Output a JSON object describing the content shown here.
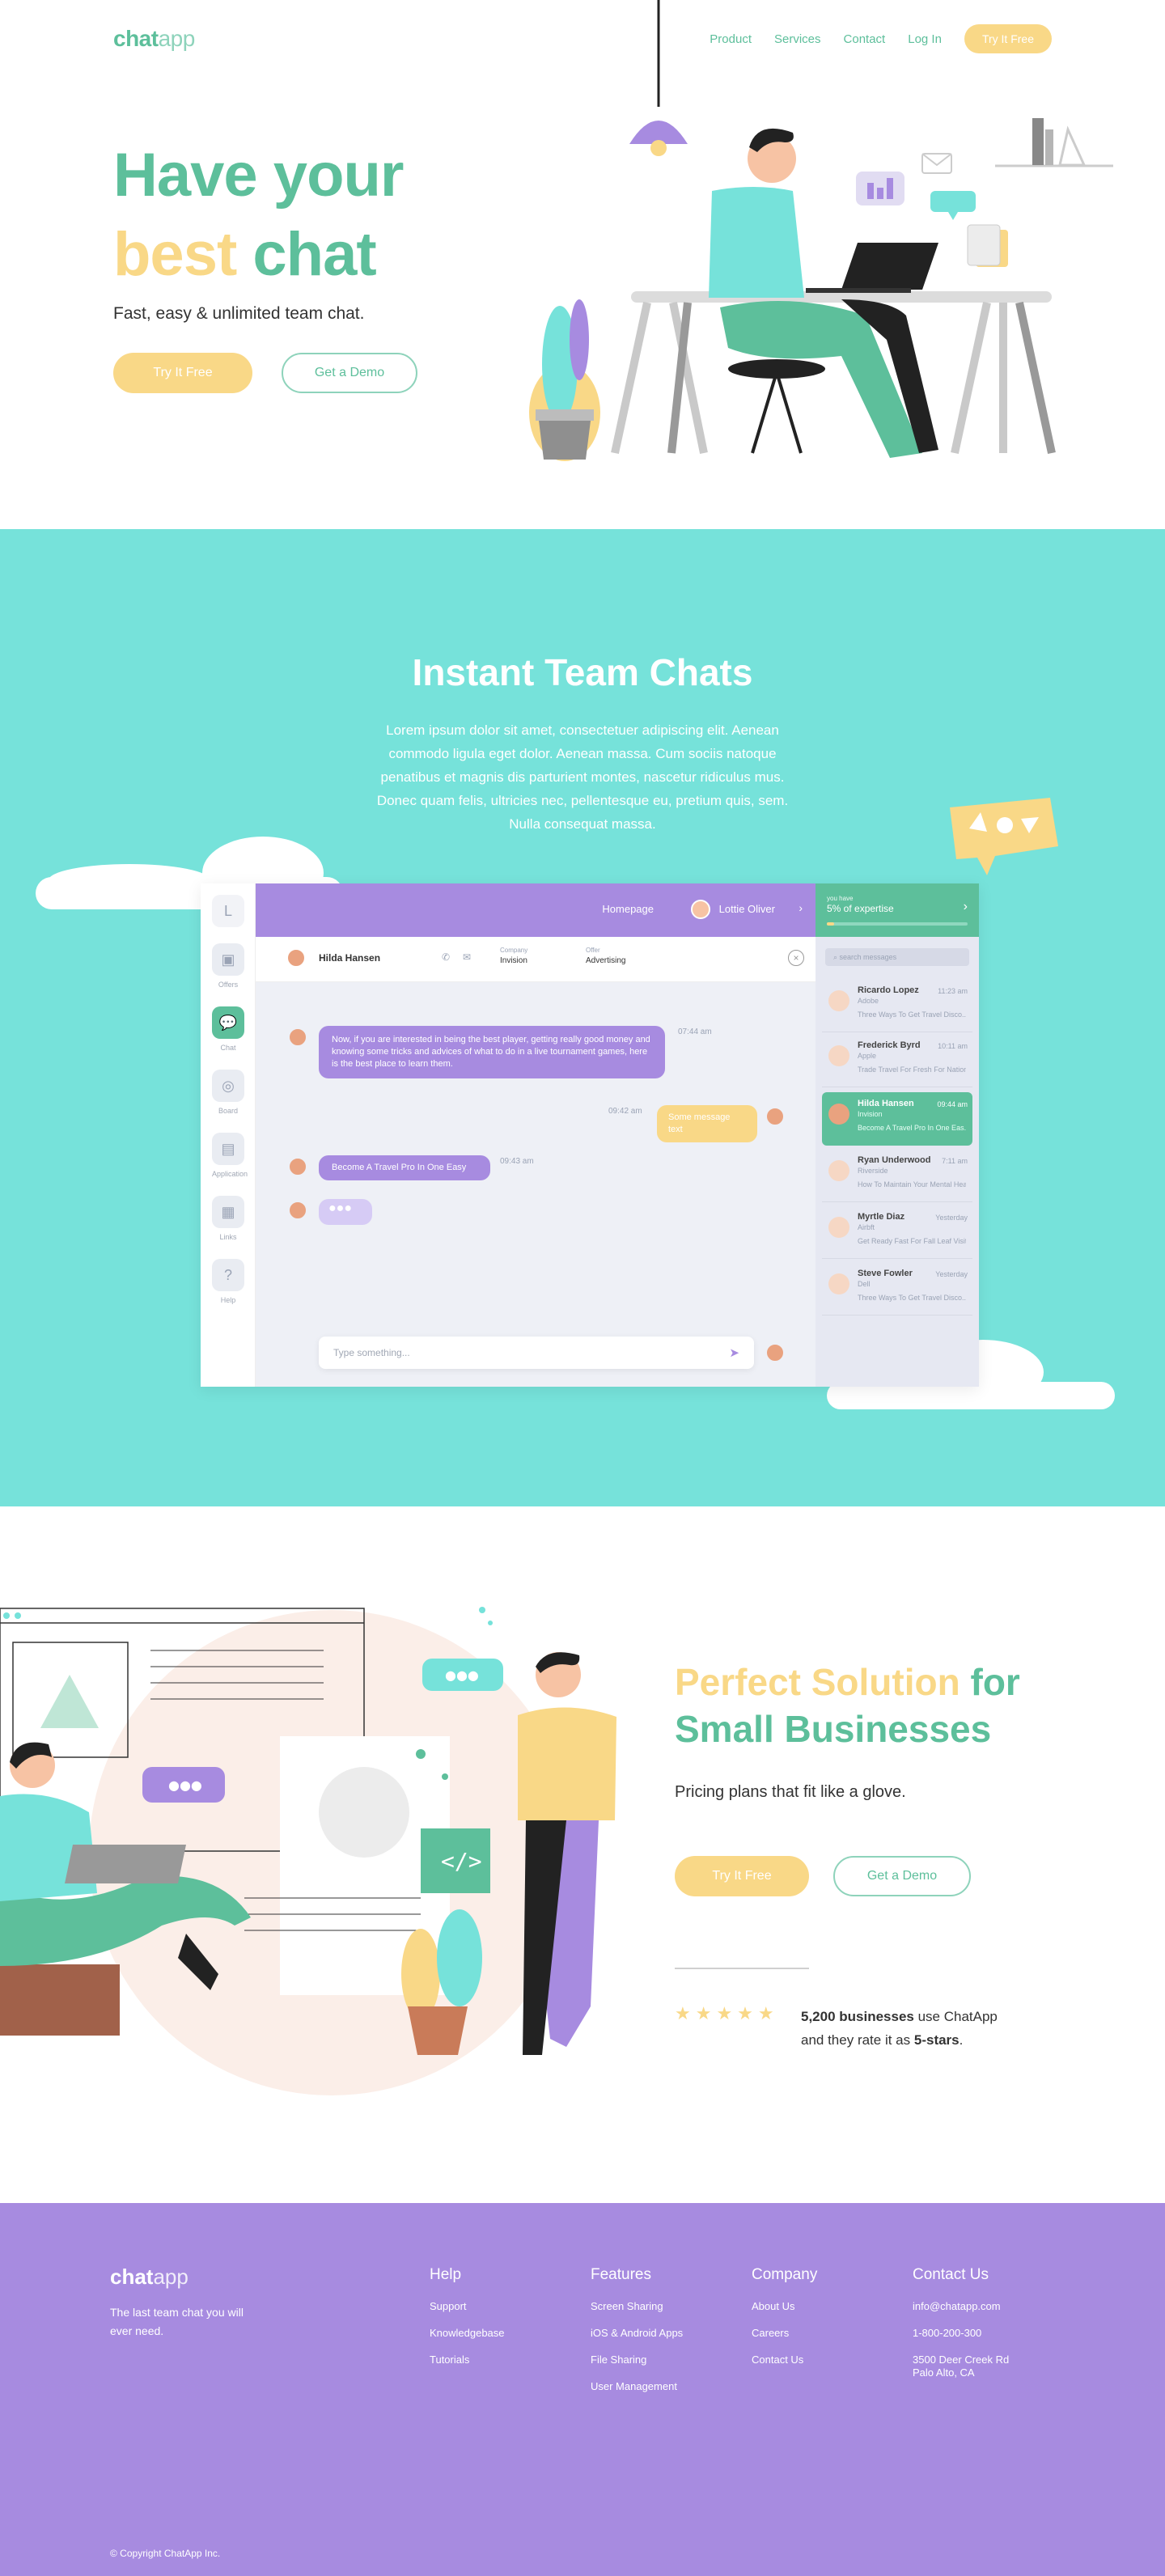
{
  "brand": {
    "logo_bold": "chat",
    "logo_light": "app"
  },
  "nav": {
    "items": [
      "Product",
      "Services",
      "Contact",
      "Log In"
    ],
    "cta": "Try It Free"
  },
  "hero": {
    "title_line1": "Have your",
    "title_line2_yellow": "best",
    "title_line2_green": " chat",
    "subtitle": "Fast, easy & unlimited team chat.",
    "primary_btn": "Try It Free",
    "secondary_btn": "Get a Demo"
  },
  "team_chats": {
    "title": "Instant Team Chats",
    "text": "Lorem ipsum dolor sit amet, consectetuer adipiscing elit. Aenean commodo ligula eget dolor. Aenean massa. Cum sociis natoque penatibus et magnis dis parturient montes, nascetur ridiculus mus. Donec quam felis, ultricies nec, pellentesque eu, pretium quis, sem. Nulla consequat massa."
  },
  "app": {
    "sidebar": [
      "Offers",
      "Chat",
      "Board",
      "Application",
      "Links",
      "Help"
    ],
    "top_bar": {
      "home": "Homepage",
      "user": "Lottie Oliver"
    },
    "chat_header": {
      "name": "Hilda Hansen",
      "company_label": "Company",
      "company": "Invision",
      "offer_label": "Offer",
      "offer": "Advertising"
    },
    "messages": [
      {
        "text": "Now, if you are interested in being the best player, getting really good money and knowing some tricks and advices of what to do in a live tournament games, here is the best place to learn them.",
        "time": "07:44 am"
      },
      {
        "text": "Some message text",
        "time": "09:42 am"
      },
      {
        "text": "Become A Travel Pro In One Easy",
        "time": "09:43 am"
      }
    ],
    "input_placeholder": "Type something...",
    "panel": {
      "label": "you have",
      "value": "5% of expertise",
      "search": "search messages"
    },
    "contacts": [
      {
        "name": "Ricardo Lopez",
        "role": "Adobe",
        "message": "Three Ways To Get Travel Disco...",
        "time": "11:23 am"
      },
      {
        "name": "Frederick Byrd",
        "role": "Apple",
        "message": "Trade Travel For Fresh For Nations",
        "time": "10:11 am"
      },
      {
        "name": "Hilda Hansen",
        "role": "Invision",
        "message": "Become A Travel Pro In One Eas...",
        "time": "09:44 am"
      },
      {
        "name": "Ryan Underwood",
        "role": "Riverside",
        "message": "How To Maintain Your Mental Heal...",
        "time": "7:11 am"
      },
      {
        "name": "Myrtle Diaz",
        "role": "Airbft",
        "message": "Get Ready Fast For Fall Leaf Visits",
        "time": "Yesterday"
      },
      {
        "name": "Steve Fowler",
        "role": "Dell",
        "message": "Three Ways To Get Travel Disco...",
        "time": "Yesterday"
      }
    ]
  },
  "solution": {
    "title_yellow": "Perfect Solution",
    "title_green": " for",
    "title_line2": "Small Businesses",
    "subtitle": "Pricing plans that fit like a glove.",
    "primary_btn": "Try It Free",
    "secondary_btn": "Get a Demo",
    "stars": "★★★★★",
    "rating_count": "5,200 businesses",
    "rating_mid": " use ChatApp",
    "rating_line2": "and they rate it as ",
    "rating_value": "5-stars",
    "rating_end": "."
  },
  "footer": {
    "logo_bold": "chat",
    "logo_light": "app",
    "tagline": "The last team chat you will ever need.",
    "columns": [
      {
        "title": "Help",
        "links": [
          "Support",
          "Knowledgebase",
          "Tutorials"
        ]
      },
      {
        "title": "Features",
        "links": [
          "Screen Sharing",
          "iOS & Android Apps",
          "File Sharing",
          "User Management"
        ]
      },
      {
        "title": "Company",
        "links": [
          "About Us",
          "Careers",
          "Contact Us"
        ]
      },
      {
        "title": "Contact Us",
        "links": [
          "info@chatapp.com",
          "1-800-200-300",
          "3500 Deer Creek Rd Palo Alto, CA"
        ]
      }
    ],
    "copyright": "© Copyright ChatApp Inc."
  },
  "colors": {
    "green": "#5dbf9b",
    "yellow": "#f9d887",
    "teal": "#76e2da",
    "purple": "#a78be0"
  }
}
